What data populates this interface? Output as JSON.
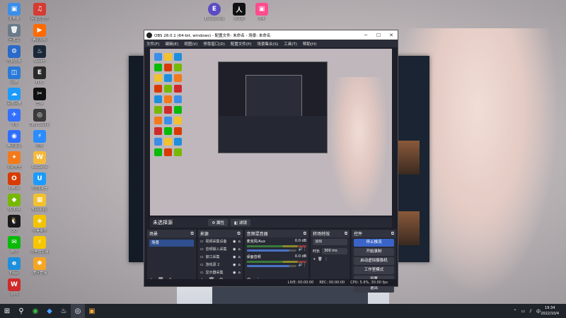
{
  "desktop_icons": [
    {
      "label": "此电脑",
      "color": "#3c8ee8",
      "glyph": "▣"
    },
    {
      "label": "回收站",
      "color": "#6a7a8a",
      "glyph": "🗑"
    },
    {
      "label": "控制面板",
      "color": "#2a6ac8",
      "glyph": "⚙"
    },
    {
      "label": "网络",
      "color": "#2a7ad8",
      "glyph": "◫"
    },
    {
      "label": "百度网盘",
      "color": "#1e9aff",
      "glyph": "☁"
    },
    {
      "label": "飞书",
      "color": "#3370ff",
      "glyph": "✈"
    },
    {
      "label": "腾讯会议",
      "color": "#2f6fff",
      "glyph": "◉"
    },
    {
      "label": "火绒安全",
      "color": "#f27a1a",
      "glyph": "✦"
    },
    {
      "label": "Office",
      "color": "#d83b01",
      "glyph": "O"
    },
    {
      "label": "NVIDIA",
      "color": "#76b900",
      "glyph": "◆"
    },
    {
      "label": "QQ",
      "color": "#1a1a1a",
      "glyph": "🐧"
    },
    {
      "label": "微信",
      "color": "#09bb07",
      "glyph": "✉"
    },
    {
      "label": "Edge",
      "color": "#1e8fdc",
      "glyph": "e"
    },
    {
      "label": "WPS",
      "color": "#cf2a2a",
      "glyph": "W"
    },
    {
      "label": "网易云音乐",
      "color": "#d43c33",
      "glyph": "♫"
    },
    {
      "label": "腾讯视频",
      "color": "#ff6a00",
      "glyph": "▶"
    },
    {
      "label": "Steam",
      "color": "#1b2838",
      "glyph": "♨"
    },
    {
      "label": "EPIC",
      "color": "#2a2a2a",
      "glyph": "E"
    },
    {
      "label": "剪映",
      "color": "#111111",
      "glyph": "✂"
    },
    {
      "label": "OBS Studio",
      "color": "#3a3a3a",
      "glyph": "◎"
    },
    {
      "label": "迅雷",
      "color": "#2b8cff",
      "glyph": "⚡"
    },
    {
      "label": "WeGame",
      "color": "#f6b93b",
      "glyph": "W"
    },
    {
      "label": "UU加速器",
      "color": "#1b9bff",
      "glyph": "U"
    },
    {
      "label": "Bandizip",
      "color": "#f2c12e",
      "glyph": "▦"
    },
    {
      "label": "完美世界",
      "color": "#f3c300",
      "glyph": "◈"
    },
    {
      "label": "雷电模拟器",
      "color": "#f6c700",
      "glyph": "⚡"
    },
    {
      "label": "虎牙直播",
      "color": "#f5a623",
      "glyph": "✱"
    }
  ],
  "top_icons": [
    {
      "label": "Everything",
      "color": "#5b4bc4",
      "glyph": "E"
    },
    {
      "label": "大头贴",
      "color": "#111111",
      "glyph": "人"
    },
    {
      "label": "快手",
      "color": "#ff4d8d",
      "glyph": "▣"
    }
  ],
  "obs": {
    "title": "OBS 28.0.1 (64-bit, windows) - 配置文件: 未命名 - 场景: 未命名",
    "menu": [
      "文件(F)",
      "编辑(E)",
      "视图(V)",
      "停靠窗口(D)",
      "配置文件(P)",
      "场景集合(S)",
      "工具(T)",
      "帮助(H)"
    ],
    "no_source": "未选择源",
    "src_props": "属性",
    "src_filters": "滤镜",
    "docks": {
      "scenes": {
        "title": "场景",
        "items": [
          "场景"
        ]
      },
      "sources": {
        "title": "来源",
        "items": [
          "视频采集设备",
          "音频输入采集",
          "窗口采集",
          "游戏源 2",
          "显示器采集"
        ]
      },
      "mixer": {
        "title": "音频混音器",
        "channels": [
          {
            "name": "麦克风/Aux",
            "db": "0.0 dB"
          },
          {
            "name": "桌面音频",
            "db": "0.0 dB"
          }
        ]
      },
      "transitions": {
        "title": "转场特效",
        "type": "淡出",
        "duration_label": "时长",
        "duration": "300 ms"
      },
      "controls": {
        "title": "控件",
        "buttons": [
          "停止推流",
          "开始录制",
          "启动虚拟摄像机",
          "工作室模式",
          "设置",
          "退出"
        ]
      }
    },
    "status": {
      "live": "LIVE: 00:00:00",
      "rec": "REC: 00:00:00",
      "cpu": "CPU: 5.6%, 30.00 fps"
    }
  },
  "taskbar": {
    "apps": [
      "⊞",
      "⚲",
      "◉",
      "◆",
      "♨",
      "◎",
      "▣"
    ],
    "tray": [
      "⌃",
      "▭",
      "♪",
      "中"
    ],
    "time": "19:34",
    "date": "2022/10/4"
  }
}
